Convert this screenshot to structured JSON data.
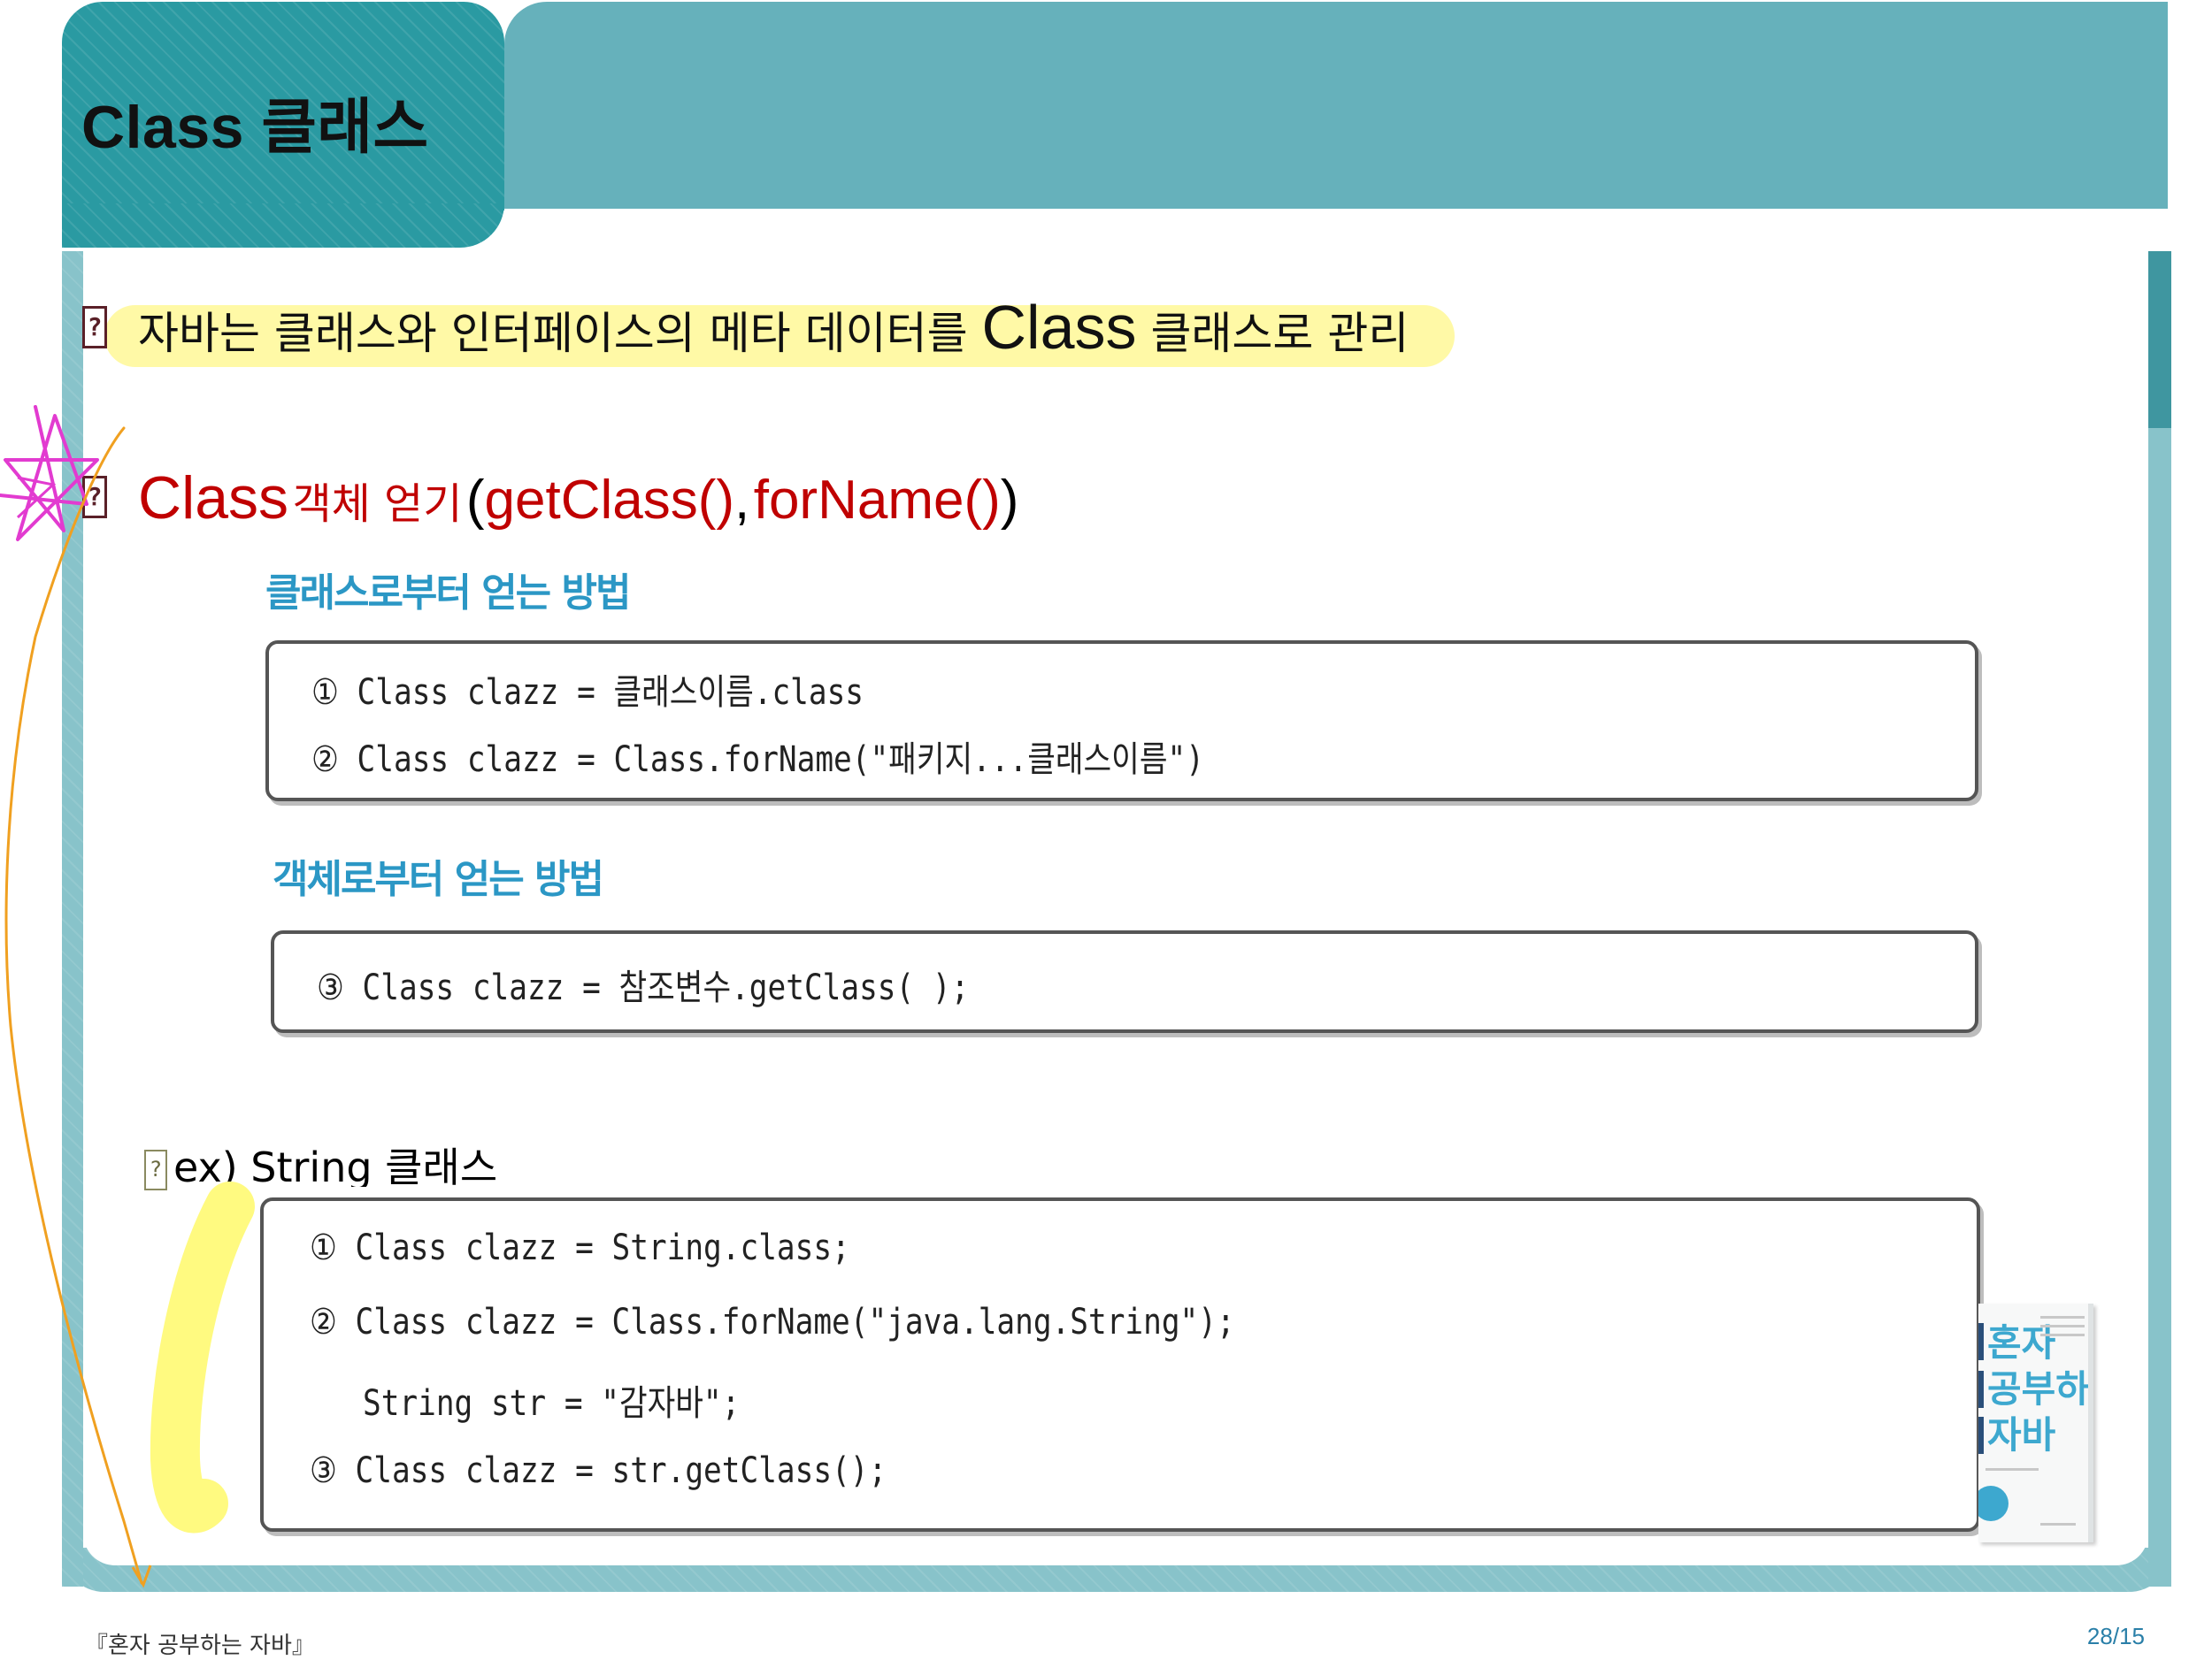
{
  "slide": {
    "title": "Class 클래스",
    "bullets": [
      {
        "marker": "?",
        "text_before": "자바는 클래스와 인터페이스의 메타 데이터를",
        "text_emphasis": "Class",
        "text_after": "클래스로 관리"
      },
      {
        "marker": "?",
        "class_word": "Class",
        "middle": "객체 얻기",
        "open_paren": "(",
        "method_1": "getClass()",
        "comma": ",",
        "method_2": "forName()",
        "close_paren": ")"
      }
    ],
    "section_from_class": {
      "heading": "클래스로부터 얻는 방법",
      "lines": [
        {
          "num": "①",
          "code": "Class clazz = 클래스이름.class"
        },
        {
          "num": "②",
          "code": "Class clazz = Class.forName(\"패키지...클래스이름\")"
        }
      ]
    },
    "section_from_object": {
      "heading": "객체로부터 얻는 방법",
      "lines": [
        {
          "num": "③",
          "code": "Class clazz = 참조변수.getClass( );"
        }
      ]
    },
    "example": {
      "marker": "?",
      "label": "ex) String 클래스",
      "lines": [
        {
          "num": "①",
          "code": "Class clazz = String.class;"
        },
        {
          "num": "②",
          "code": "Class clazz = Class.forName(\"java.lang.String\");"
        },
        {
          "num": "",
          "code": "String str = \"감자바\";"
        },
        {
          "num": "③",
          "code": "Class clazz = str.getClass();"
        }
      ]
    },
    "book_cover": {
      "lines": [
        "혼자",
        "공부하는",
        "자바"
      ]
    }
  },
  "footer": {
    "book_title": "『혼자 공부하는 자바』",
    "page_number": "28/15"
  },
  "colors": {
    "header_tab": "#2a9aa2",
    "header_bar": "#66b1bb",
    "frame": "#88c3ca",
    "title_text": "#111111",
    "accent_red": "#c00000",
    "subhead_blue": "#2b97c5",
    "highlight_yellow": "#fff9a6",
    "annotation_pink": "#e23bd0",
    "annotation_orange": "#f0a020"
  }
}
